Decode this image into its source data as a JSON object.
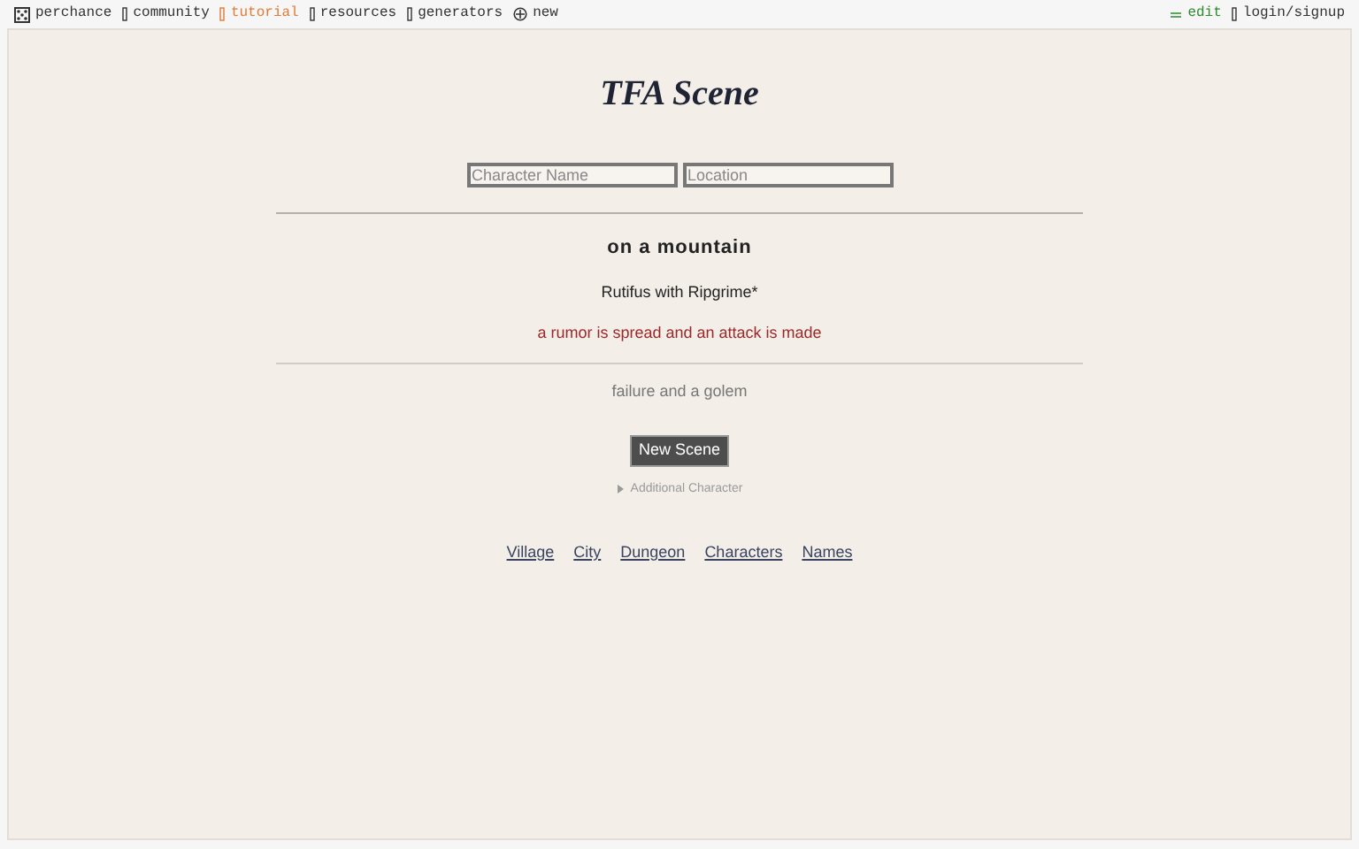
{
  "top_nav": {
    "left": [
      {
        "label": "perchance",
        "kind": "home"
      },
      {
        "label": "community",
        "kind": "link"
      },
      {
        "label": "tutorial",
        "kind": "highlight"
      },
      {
        "label": "resources",
        "kind": "link"
      },
      {
        "label": "generators",
        "kind": "link"
      },
      {
        "label": "new",
        "kind": "new"
      }
    ],
    "right": [
      {
        "label": "edit",
        "kind": "edit"
      },
      {
        "label": "login/signup",
        "kind": "link"
      }
    ]
  },
  "title": "TFA Scene",
  "fields": [
    {
      "placeholder": "Character Name"
    },
    {
      "placeholder": "Location"
    }
  ],
  "scene": {
    "location": "on a mountain",
    "characters": "Rutifus with Ripgrime*",
    "event": "a rumor is spread and an attack is made",
    "outcome": "failure and a golem"
  },
  "button": "New Scene",
  "additional": {
    "label": "Additional Character",
    "expanded": false
  },
  "links": [
    "Village",
    "City",
    "Dungeon",
    "Characters",
    "Names"
  ]
}
